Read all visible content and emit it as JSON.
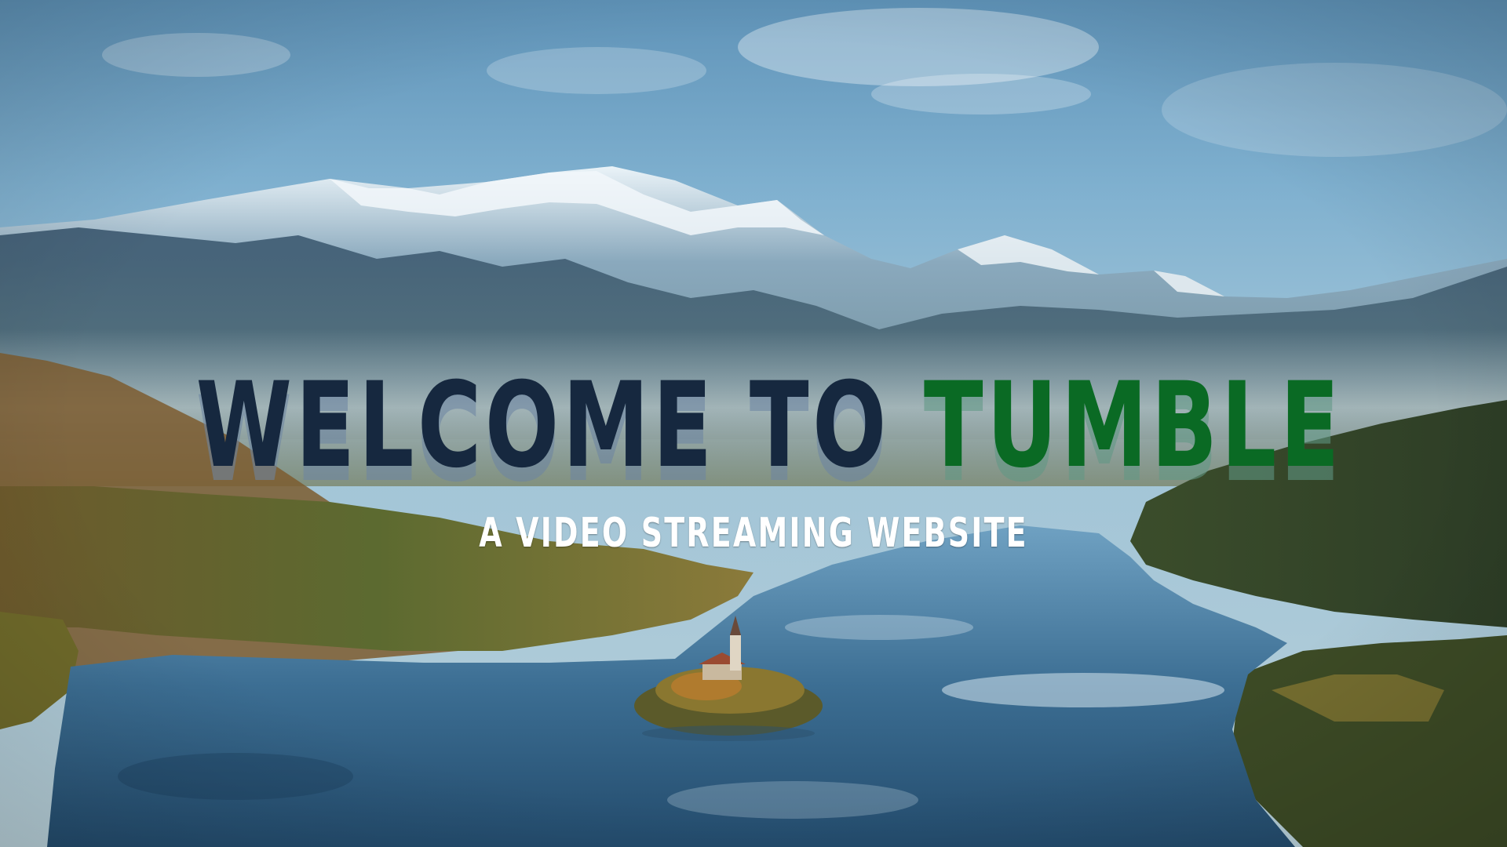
{
  "hero": {
    "title_part1": "WELCOME TO ",
    "title_part2": "TUMBLE",
    "subtitle": "A VIDEO STREAMING WEBSITE"
  },
  "colors": {
    "title_dark": "#16283f",
    "title_brand": "#0a6a24",
    "subtitle": "#ffffff"
  }
}
